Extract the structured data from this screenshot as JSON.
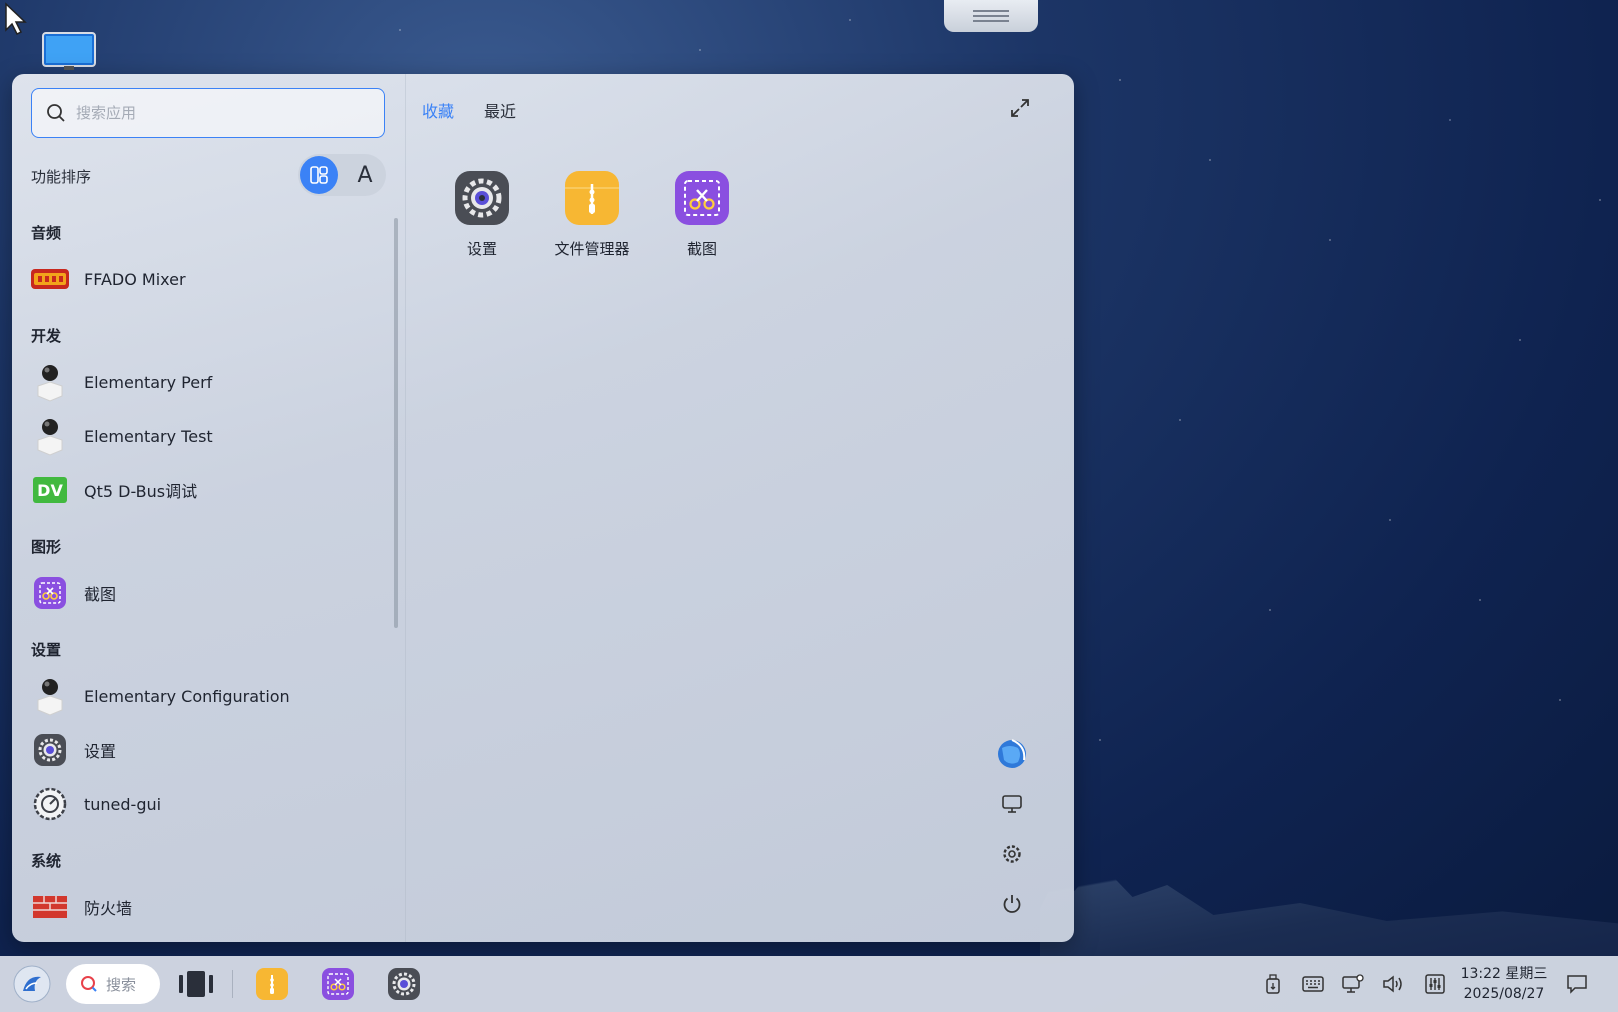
{
  "search": {
    "placeholder": "搜索应用"
  },
  "sort": {
    "label": "功能排序",
    "alpha_label": "A"
  },
  "categories": [
    {
      "name": "音频",
      "apps": [
        "FFADO Mixer"
      ]
    },
    {
      "name": "开发",
      "apps": [
        "Elementary Perf",
        "Elementary Test",
        "Qt5 D-Bus调试"
      ]
    },
    {
      "name": "图形",
      "apps": [
        "截图"
      ]
    },
    {
      "name": "设置",
      "apps": [
        "Elementary Configuration",
        "设置",
        "tuned-gui"
      ]
    },
    {
      "name": "系统",
      "apps": [
        "防火墙"
      ]
    }
  ],
  "tabs": {
    "favorites": "收藏",
    "recent": "最近"
  },
  "favorites": [
    {
      "label": "设置",
      "icon": "settings-gear-icon"
    },
    {
      "label": "文件管理器",
      "icon": "file-manager-icon"
    },
    {
      "label": "截图",
      "icon": "screenshot-icon"
    }
  ],
  "taskbar": {
    "search_label": "搜索",
    "time": "13:22 星期三",
    "date": "2025/08/27"
  },
  "colors": {
    "accent": "#3b82f6",
    "file_manager": "#f7b733",
    "screenshot": "#8a4fe0"
  }
}
